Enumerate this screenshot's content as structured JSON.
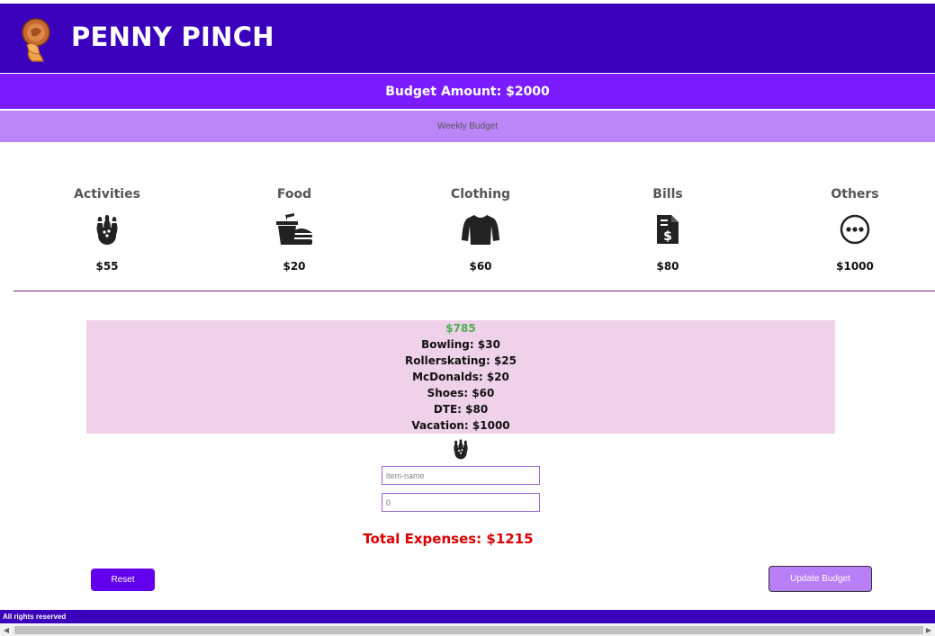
{
  "app": {
    "title": "PENNY PINCH"
  },
  "budget": {
    "amount_label": "Budget Amount: $2000",
    "period": "Weekly Budget"
  },
  "categories": [
    {
      "name": "Activities",
      "amount": "$55",
      "icon": "bowling-icon"
    },
    {
      "name": "Food",
      "amount": "$20",
      "icon": "fastfood-icon"
    },
    {
      "name": "Clothing",
      "amount": "$60",
      "icon": "shirt-icon"
    },
    {
      "name": "Bills",
      "amount": "$80",
      "icon": "bill-icon"
    },
    {
      "name": "Others",
      "amount": "$1000",
      "icon": "more-icon"
    }
  ],
  "expenses": {
    "remaining": "$785",
    "items": [
      "Bowling: $30",
      "Rollerskating: $25",
      "McDonalds: $20",
      "Shoes: $60",
      "DTE: $80",
      "Vacation: $1000"
    ]
  },
  "form": {
    "selected_category_icon": "bowling-icon",
    "item_name_placeholder": "item-name",
    "amount_value": "0"
  },
  "totals": {
    "total_expenses": "Total Expenses: $1215"
  },
  "buttons": {
    "reset": "Reset",
    "update": "Update Budget"
  },
  "footer": {
    "text": "All rights reserved"
  },
  "colors": {
    "header": "#3a00bc",
    "budget_bar": "#7a1cff",
    "period_bar": "#bb86f8",
    "expense_box": "#efd1ea",
    "remaining": "#4cb050",
    "total": "#e00000"
  }
}
